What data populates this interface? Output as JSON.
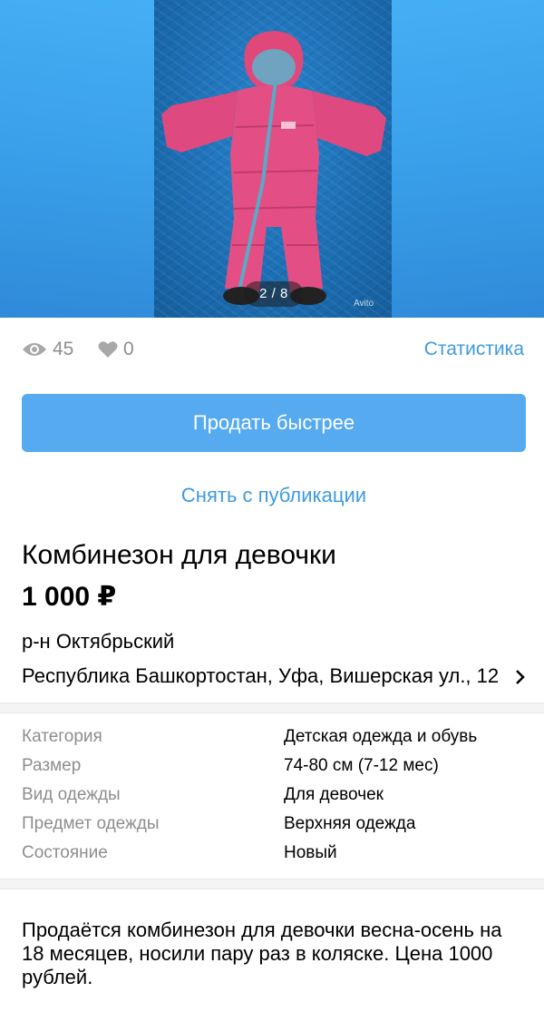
{
  "gallery": {
    "counter": "2 / 8",
    "watermark": "Avito"
  },
  "stats": {
    "views": "45",
    "favorites": "0",
    "link_label": "Статистика"
  },
  "actions": {
    "sell_faster_label": "Продать быстрее",
    "unpublish_label": "Снять с публикации"
  },
  "listing": {
    "title": "Комбинезон для девочки",
    "price": "1 000 ₽",
    "district": "р-н Октябрьский",
    "address": "Республика Башкортостан, Уфа, Вишерская ул., 12"
  },
  "params": [
    {
      "name": "Категория",
      "value": "Детская одежда и обувь"
    },
    {
      "name": "Размер",
      "value": "74-80 см (7-12 мес)"
    },
    {
      "name": "Вид одежды",
      "value": "Для девочек"
    },
    {
      "name": "Предмет одежды",
      "value": "Верхняя одежда"
    },
    {
      "name": "Состояние",
      "value": "Новый"
    }
  ],
  "description": "Продаётся комбинезон для девочки весна-осень на 18 месяцев, носили пару раз в коляске. Цена 1000 рублей.",
  "colors": {
    "accent": "#3d9be0",
    "button": "#56aaf0",
    "muted": "#8e8e8e"
  }
}
